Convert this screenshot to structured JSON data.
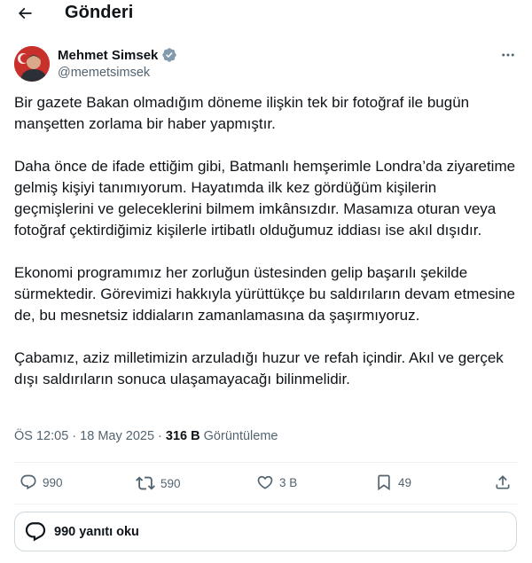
{
  "header": {
    "title": "Gönderi"
  },
  "author": {
    "name": "Mehmet Simsek",
    "handle": "@memetsimsek"
  },
  "tweet": {
    "paragraphs": [
      "Bir gazete Bakan olmadığım döneme ilişkin tek bir fotoğraf ile bugün manşetten zorlama bir haber yapmıştır.",
      "Daha önce de ifade ettiğim gibi, Batmanlı hemşerimle Londra’da ziyaretime gelmiş kişiyi tanımıyorum. Hayatımda ilk kez gördüğüm kişilerin geçmişlerini ve geleceklerini bilmem imkânsızdır. Masamıza oturan veya fotoğraf çektirdiğimiz kişilerle irtibatlı olduğumuz iddiası ise akıl dışıdır.",
      "Ekonomi programımız her zorluğun üstesinden gelip başarılı şekilde sürmektedir. Görevimizi hakkıyla yürüttükçe bu saldırıların devam etmesine de, bu mesnetsiz iddiaların zamanlamasına da şaşırmıyoruz.",
      "Çabamız, aziz milletimizin arzuladığı huzur ve refah içindir. Akıl ve gerçek dışı saldırıların sonuca ulaşamayacağı bilinmelidir."
    ],
    "time": "ÖS 12:05",
    "separator": "·",
    "date": "18 May 2025",
    "views_count": "316 B",
    "views_label": "Görüntüleme"
  },
  "actions": {
    "replies": "990",
    "reposts": "590",
    "likes": "3 B",
    "bookmarks": "49"
  },
  "reply_prompt": "990 yanıtı oku",
  "colors": {
    "text": "#0f1419",
    "secondary": "#536471",
    "verified": "#829aab",
    "divider": "#eff3f4",
    "avatar_bg": "#c9302c"
  }
}
